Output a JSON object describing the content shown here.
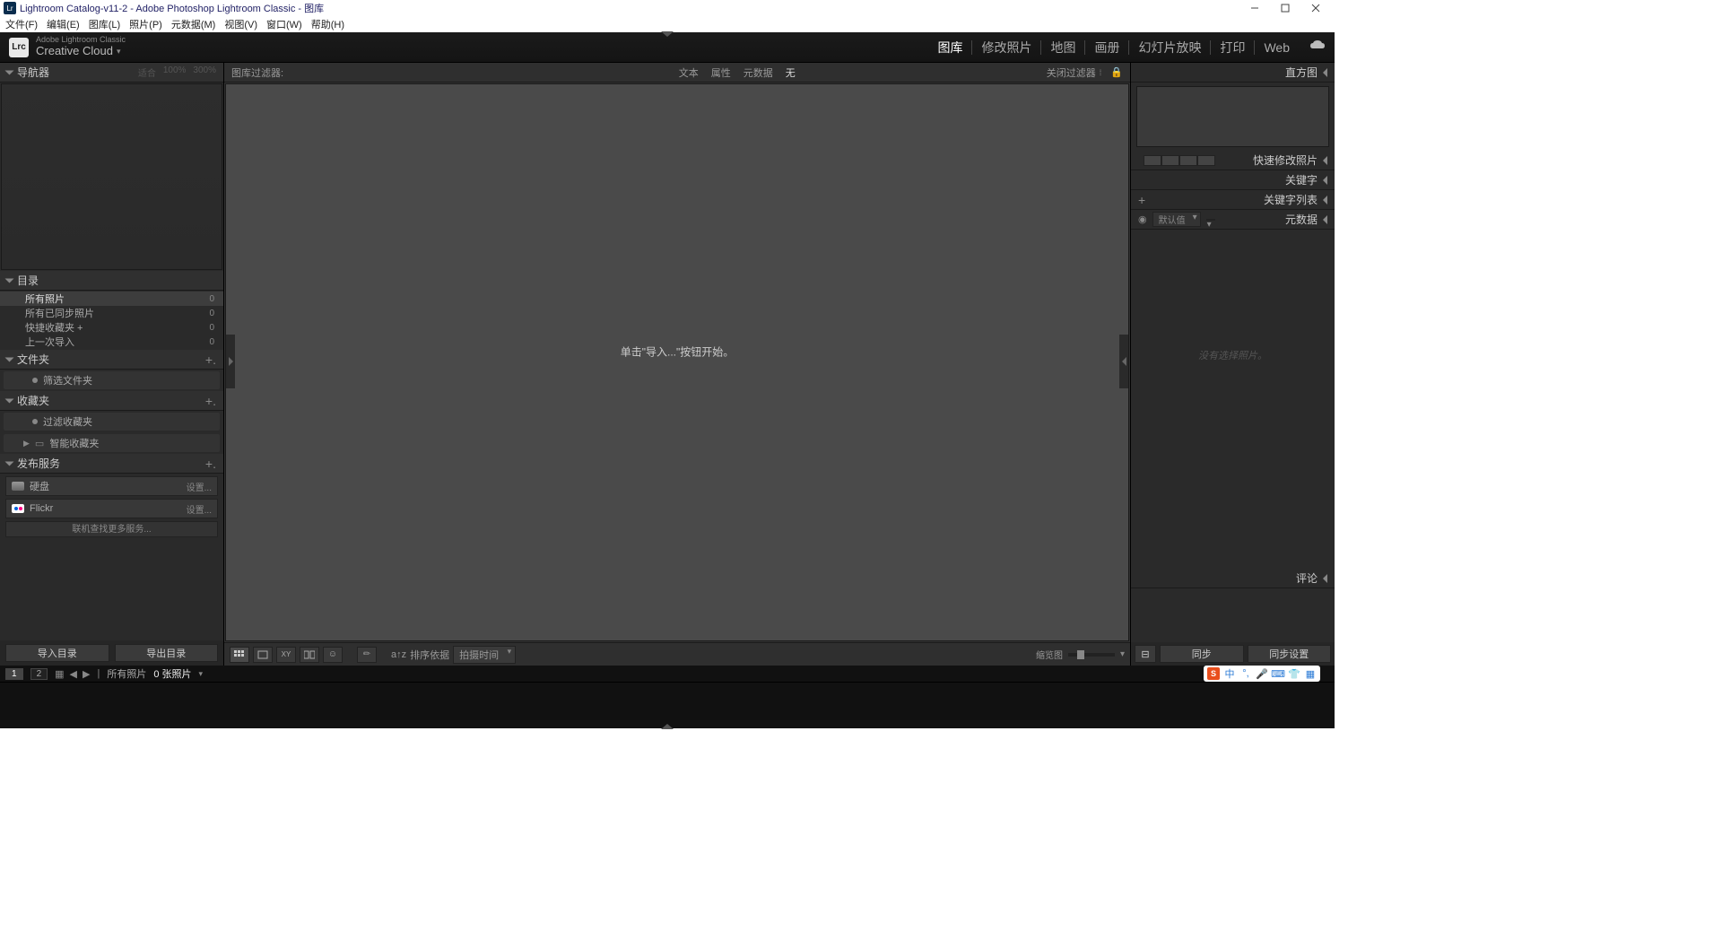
{
  "title": "Lightroom Catalog-v11-2 - Adobe Photoshop Lightroom Classic - 图库",
  "menubar": [
    "文件(F)",
    "编辑(E)",
    "图库(L)",
    "照片(P)",
    "元数据(M)",
    "视图(V)",
    "窗口(W)",
    "帮助(H)"
  ],
  "brand": {
    "line1": "Adobe Lightroom Classic",
    "line2": "Creative Cloud",
    "logo": "Lrc"
  },
  "modules": [
    "图库",
    "修改照片",
    "地图",
    "画册",
    "幻灯片放映",
    "打印",
    "Web"
  ],
  "active_module": "图库",
  "left": {
    "navigator": {
      "title": "导航器",
      "extras": [
        "适合",
        "100%",
        "300%"
      ]
    },
    "catalog": {
      "title": "目录",
      "items": [
        {
          "label": "所有照片",
          "count": "0",
          "selected": true
        },
        {
          "label": "所有已同步照片",
          "count": "0"
        },
        {
          "label": "快捷收藏夹 +",
          "count": "0"
        },
        {
          "label": "上一次导入",
          "count": "0"
        }
      ]
    },
    "folders": {
      "title": "文件夹",
      "filter": "筛选文件夹"
    },
    "collections": {
      "title": "收藏夹",
      "filter": "过滤收藏夹",
      "smart": "智能收藏夹"
    },
    "publish": {
      "title": "发布服务",
      "services": [
        {
          "label": "硬盘",
          "action": "设置..."
        },
        {
          "label": "Flickr",
          "action": "设置..."
        }
      ],
      "more": "联机查找更多服务..."
    },
    "buttons": {
      "import": "导入目录",
      "export": "导出目录"
    }
  },
  "center": {
    "filter": {
      "title": "图库过滤器:",
      "tabs": [
        "文本",
        "属性",
        "元数据",
        "无"
      ],
      "active": "无",
      "preset": "关闭过滤器"
    },
    "empty_msg": "单击\"导入...\"按钮开始。",
    "toolbar": {
      "sort_label": "排序依据",
      "sort_value": "拍摄时间",
      "thumb_label": "缩览图"
    }
  },
  "right": {
    "histogram": "直方图",
    "quick": "快速修改照片",
    "keywords": "关键字",
    "keywordlist": "关键字列表",
    "metadata": {
      "title": "元数据",
      "preset": "默认值",
      "nosel": "没有选择照片。"
    },
    "comments": "评论",
    "sync": "同步",
    "sync_settings": "同步设置"
  },
  "status": {
    "pages": [
      "1",
      "2"
    ],
    "path": "所有照片",
    "count": "0 张照片"
  },
  "ime": {
    "badge": "S",
    "mode": "中"
  }
}
